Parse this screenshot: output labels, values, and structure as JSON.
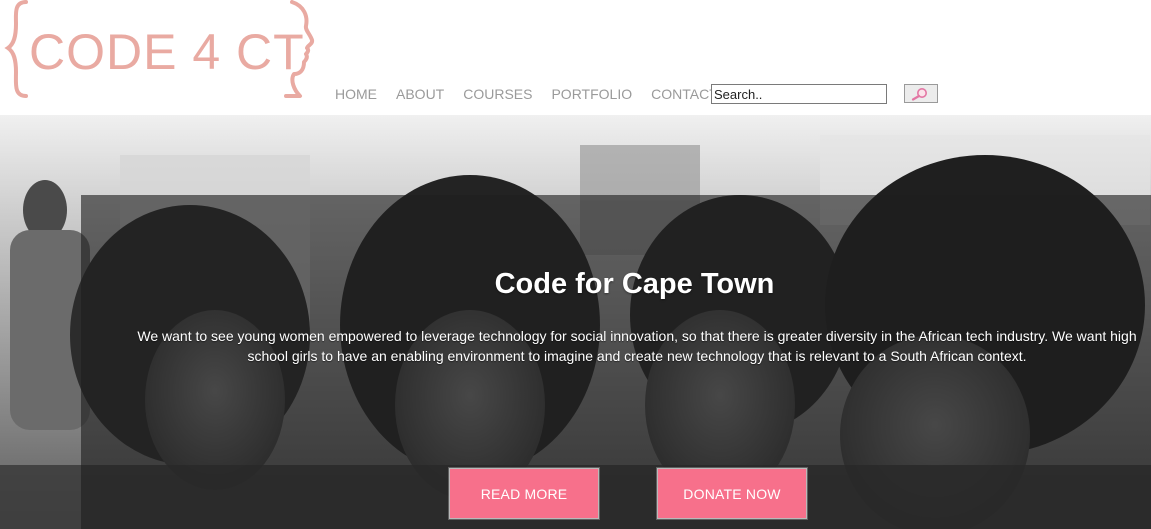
{
  "logo": {
    "text": "CODE 4 CT",
    "color": "#e9aaa2"
  },
  "nav": {
    "items": [
      {
        "label": "HOME"
      },
      {
        "label": "ABOUT"
      },
      {
        "label": "COURSES"
      },
      {
        "label": "PORTFOLIO"
      },
      {
        "label": "CONTACT"
      }
    ]
  },
  "search": {
    "placeholder": "Search..",
    "button_icon": "magnifier-icon"
  },
  "hero": {
    "title": "Code for Cape Town",
    "text": "We want to see young women empowered to leverage technology for social innovation, so that there is greater diversity in the African tech industry. We want high school girls to have an enabling environment to imagine and create new technology that is relevant to a South African context.",
    "buttons": {
      "read_more": "READ MORE",
      "donate_now": "DONATE NOW"
    },
    "button_color": "#f7708b"
  }
}
